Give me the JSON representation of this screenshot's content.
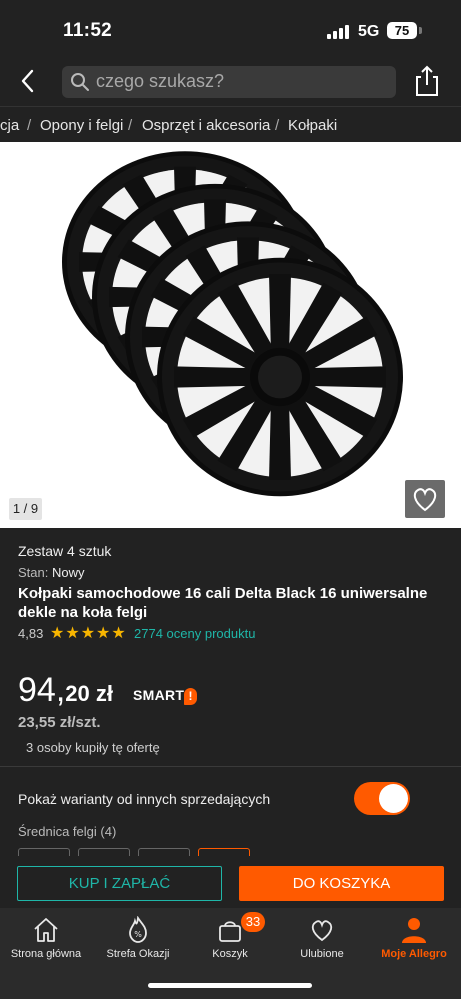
{
  "status": {
    "time": "11:52",
    "network": "5G",
    "battery": "75"
  },
  "header": {
    "search_placeholder": "czego szukasz?",
    "back_icon": "chevron-left-icon",
    "share_icon": "share-icon"
  },
  "breadcrumbs": [
    "cja",
    "Opony i felgi",
    "Osprzęt i akcesoria",
    "Kołpaki"
  ],
  "gallery": {
    "counter": "1 / 9"
  },
  "product": {
    "set": "Zestaw 4 sztuk",
    "condition_label": "Stan:",
    "condition_value": "Nowy",
    "title": "Kołpaki samochodowe 16 cali Delta Black 16 uniwersalne dekle na koła felgi",
    "rating": "4,83",
    "rating_stars": 5,
    "rating_count_text": "2774 oceny produktu",
    "price_main": "94,",
    "price_cents": "20 zł",
    "smart_label": "SMART",
    "unit_price": "23,55 zł/szt.",
    "buyers_text": "3 osoby kupiły tę ofertę"
  },
  "variants": {
    "label": "Pokaż warianty od innych sprzedających",
    "toggle_on": true,
    "rim_label": "Średnica felgi (4)"
  },
  "actions": {
    "buy_label": "KUP I ZAPŁAĆ",
    "cart_label": "DO KOSZYKA"
  },
  "tabs": [
    {
      "label": "Strona główna",
      "icon": "home-icon"
    },
    {
      "label": "Strefa Okazji",
      "icon": "deals-icon"
    },
    {
      "label": "Koszyk",
      "icon": "cart-icon",
      "badge": "33"
    },
    {
      "label": "Ulubione",
      "icon": "heart-icon"
    },
    {
      "label": "Moje Allegro",
      "icon": "user-icon",
      "active": true
    }
  ],
  "colors": {
    "accent": "#ff5a00",
    "teal": "#1fb6a8",
    "star": "#f7b500",
    "background": "#222222"
  }
}
